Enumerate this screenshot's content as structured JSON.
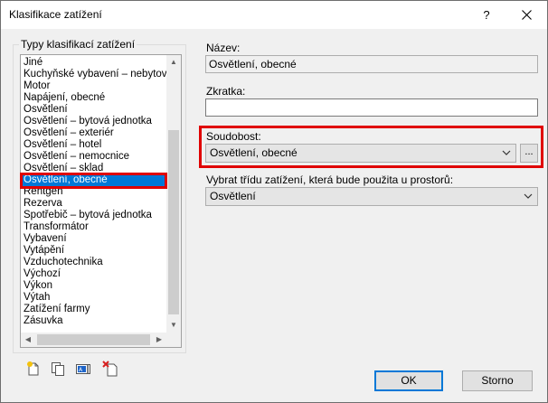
{
  "window": {
    "title": "Klasifikace zatížení",
    "help_label": "?"
  },
  "load_types": {
    "group_label": "Typy klasifikací zatížení",
    "items": [
      "Jiné",
      "Kuchyňské vybavení – nebytová",
      "Motor",
      "Napájení, obecné",
      "Osvětlení",
      "Osvětlení – bytová jednotka",
      "Osvětlení – exteriér",
      "Osvětlení – hotel",
      "Osvětlení – nemocnice",
      "Osvětlení – sklad",
      "Osvětlení, obecné",
      "Rentgen",
      "Rezerva",
      "Spotřebič – bytová jednotka",
      "Transformátor",
      "Vybavení",
      "Vytápění",
      "Vzduchotechnika",
      "Výchozí",
      "Výkon",
      "Výtah",
      "Zatížení farmy",
      "Zásuvka"
    ],
    "selected_index": 10
  },
  "form": {
    "name_label": "Název:",
    "name_value": "Osvětlení, obecné",
    "abbrev_label": "Zkratka:",
    "abbrev_value": "",
    "demand_label": "Soudobost:",
    "demand_value": "Osvětlení, obecné",
    "browse_label": "...",
    "space_class_label": "Vybrat třídu zatížení, která bude použita u prostorů:",
    "space_class_value": "Osvětlení"
  },
  "buttons": {
    "ok": "OK",
    "cancel": "Storno"
  },
  "toolbar_icons": [
    "new-icon",
    "duplicate-icon",
    "rename-icon",
    "delete-icon"
  ],
  "colors": {
    "accent": "#0078d7",
    "highlight_frame": "#e00000"
  }
}
